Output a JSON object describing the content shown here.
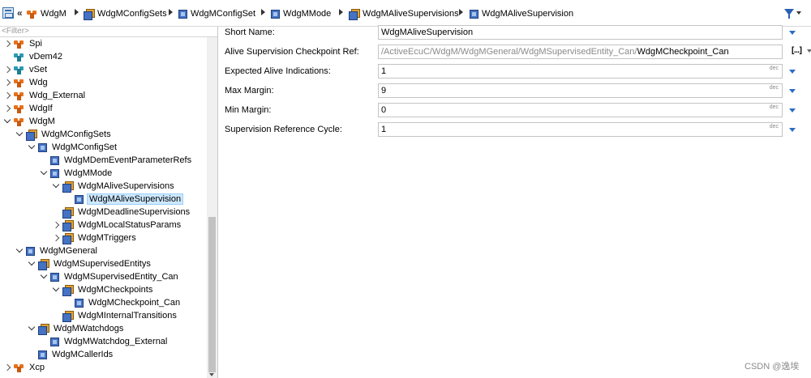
{
  "breadcrumb": {
    "items": [
      {
        "label": "WdgM",
        "icon": "module-icon"
      },
      {
        "label": "WdgMConfigSets",
        "icon": "multi-container-icon"
      },
      {
        "label": "WdgMConfigSet",
        "icon": "container-icon"
      },
      {
        "label": "WdgMMode",
        "icon": "container-icon"
      },
      {
        "label": "WdgMAliveSupervisions",
        "icon": "multi-container-icon"
      },
      {
        "label": "WdgMAliveSupervision",
        "icon": "container-icon"
      }
    ]
  },
  "tree": {
    "filter_placeholder": "<Filter>",
    "rows": [
      {
        "label": "Spi",
        "indent": 0,
        "toggle": "collapsed",
        "icon": "module-icon"
      },
      {
        "label": "vDem42",
        "indent": 0,
        "toggle": "none",
        "icon": "module-teal-icon"
      },
      {
        "label": "vSet",
        "indent": 0,
        "toggle": "collapsed",
        "icon": "module-teal-icon"
      },
      {
        "label": "Wdg",
        "indent": 0,
        "toggle": "collapsed",
        "icon": "module-icon"
      },
      {
        "label": "Wdg_External",
        "indent": 0,
        "toggle": "collapsed",
        "icon": "module-icon"
      },
      {
        "label": "WdgIf",
        "indent": 0,
        "toggle": "collapsed",
        "icon": "module-icon"
      },
      {
        "label": "WdgM",
        "indent": 0,
        "toggle": "expanded",
        "icon": "module-icon"
      },
      {
        "label": "WdgMConfigSets",
        "indent": 1,
        "toggle": "expanded",
        "icon": "multi-container-icon"
      },
      {
        "label": "WdgMConfigSet",
        "indent": 2,
        "toggle": "expanded",
        "icon": "container-icon"
      },
      {
        "label": "WdgMDemEventParameterRefs",
        "indent": 3,
        "toggle": "none",
        "icon": "container-icon"
      },
      {
        "label": "WdgMMode",
        "indent": 3,
        "toggle": "expanded",
        "icon": "container-icon"
      },
      {
        "label": "WdgMAliveSupervisions",
        "indent": 4,
        "toggle": "expanded",
        "icon": "multi-container-icon"
      },
      {
        "label": "WdgMAliveSupervision",
        "indent": 5,
        "toggle": "none",
        "icon": "container-icon",
        "selected": true
      },
      {
        "label": "WdgMDeadlineSupervisions",
        "indent": 4,
        "toggle": "none",
        "icon": "multi-container-icon"
      },
      {
        "label": "WdgMLocalStatusParams",
        "indent": 4,
        "toggle": "collapsed",
        "icon": "multi-container-icon"
      },
      {
        "label": "WdgMTriggers",
        "indent": 4,
        "toggle": "collapsed",
        "icon": "multi-container-icon"
      },
      {
        "label": "WdgMGeneral",
        "indent": 1,
        "toggle": "expanded",
        "icon": "container-icon"
      },
      {
        "label": "WdgMSupervisedEntitys",
        "indent": 2,
        "toggle": "expanded",
        "icon": "multi-container-icon"
      },
      {
        "label": "WdgMSupervisedEntity_Can",
        "indent": 3,
        "toggle": "expanded",
        "icon": "container-icon"
      },
      {
        "label": "WdgMCheckpoints",
        "indent": 4,
        "toggle": "expanded",
        "icon": "multi-container-icon"
      },
      {
        "label": "WdgMCheckpoint_Can",
        "indent": 5,
        "toggle": "none",
        "icon": "container-icon"
      },
      {
        "label": "WdgMInternalTransitions",
        "indent": 4,
        "toggle": "none",
        "icon": "multi-container-icon"
      },
      {
        "label": "WdgMWatchdogs",
        "indent": 2,
        "toggle": "expanded",
        "icon": "multi-container-icon"
      },
      {
        "label": "WdgMWatchdog_External",
        "indent": 3,
        "toggle": "none",
        "icon": "container-icon"
      },
      {
        "label": "WdgMCallerIds",
        "indent": 2,
        "toggle": "none",
        "icon": "container-icon"
      },
      {
        "label": "Xcp",
        "indent": 0,
        "toggle": "collapsed",
        "icon": "module-icon"
      }
    ]
  },
  "form": {
    "short_name": {
      "label": "Short Name:",
      "value": "WdgMAliveSupervision"
    },
    "checkpoint_ref": {
      "label": "Alive Supervision Checkpoint Ref:",
      "path": "/ActiveEcuC/WdgM/WdgMGeneral/WdgMSupervisedEntity_Can/",
      "target": "WdgMCheckpoint_Can",
      "browse_label": "[...]"
    },
    "expected_alive": {
      "label": "Expected Alive Indications:",
      "value": "1",
      "format": "dec"
    },
    "max_margin": {
      "label": "Max Margin:",
      "value": "9",
      "format": "dec"
    },
    "min_margin": {
      "label": "Min Margin:",
      "value": "0",
      "format": "dec"
    },
    "ref_cycle": {
      "label": "Supervision Reference Cycle:",
      "value": "1",
      "format": "dec"
    }
  },
  "watermark": "CSDN @逸埃"
}
